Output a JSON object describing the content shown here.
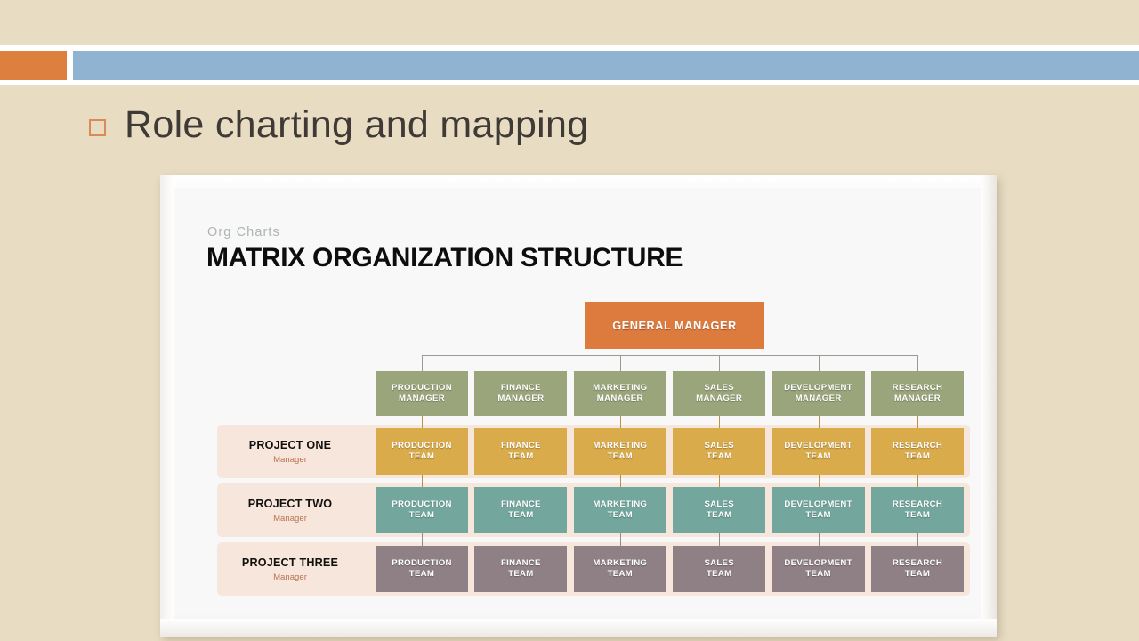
{
  "slide": {
    "heading": "Role charting and mapping",
    "bullet_icon": "hollow-square-bullet-icon",
    "banner": {
      "accent_color": "#dd7f3f",
      "bar_color": "#91b3d2",
      "background_color": "#e8dcc3"
    }
  },
  "chart_data": {
    "type": "diagram",
    "diagram_type": "matrix-organization-chart",
    "eyebrow": "Org Charts",
    "title": "MATRIX ORGANIZATION STRUCTURE",
    "root": {
      "label": "GENERAL MANAGER",
      "color": "#dd7b3f"
    },
    "functions": [
      "PRODUCTION",
      "FINANCE",
      "MARKETING",
      "SALES",
      "DEVELOPMENT",
      "RESEARCH"
    ],
    "manager_row": {
      "suffix": "MANAGER",
      "color": "#9ba57c",
      "nodes": [
        "PRODUCTION MANAGER",
        "FINANCE MANAGER",
        "MARKETING MANAGER",
        "SALES MANAGER",
        "DEVELOPMENT MANAGER",
        "RESEARCH MANAGER"
      ]
    },
    "project_rows": [
      {
        "name": "PROJECT ONE",
        "sub": "Manager",
        "color": "#d9ab4b",
        "band_color": "#f7e6dc",
        "nodes": [
          "PRODUCTION TEAM",
          "FINANCE TEAM",
          "MARKETING TEAM",
          "SALES TEAM",
          "DEVELOPMENT TEAM",
          "RESEARCH TEAM"
        ]
      },
      {
        "name": "PROJECT TWO",
        "sub": "Manager",
        "color": "#73a79d",
        "band_color": "#f7e6dc",
        "nodes": [
          "PRODUCTION TEAM",
          "FINANCE TEAM",
          "MARKETING TEAM",
          "SALES TEAM",
          "DEVELOPMENT TEAM",
          "RESEARCH TEAM"
        ]
      },
      {
        "name": "PROJECT THREE",
        "sub": "Manager",
        "color": "#8e8084",
        "band_color": "#f7e6dc",
        "nodes": [
          "PRODUCTION TEAM",
          "FINANCE TEAM",
          "MARKETING TEAM",
          "SALES TEAM",
          "DEVELOPMENT TEAM",
          "RESEARCH TEAM"
        ]
      }
    ]
  }
}
